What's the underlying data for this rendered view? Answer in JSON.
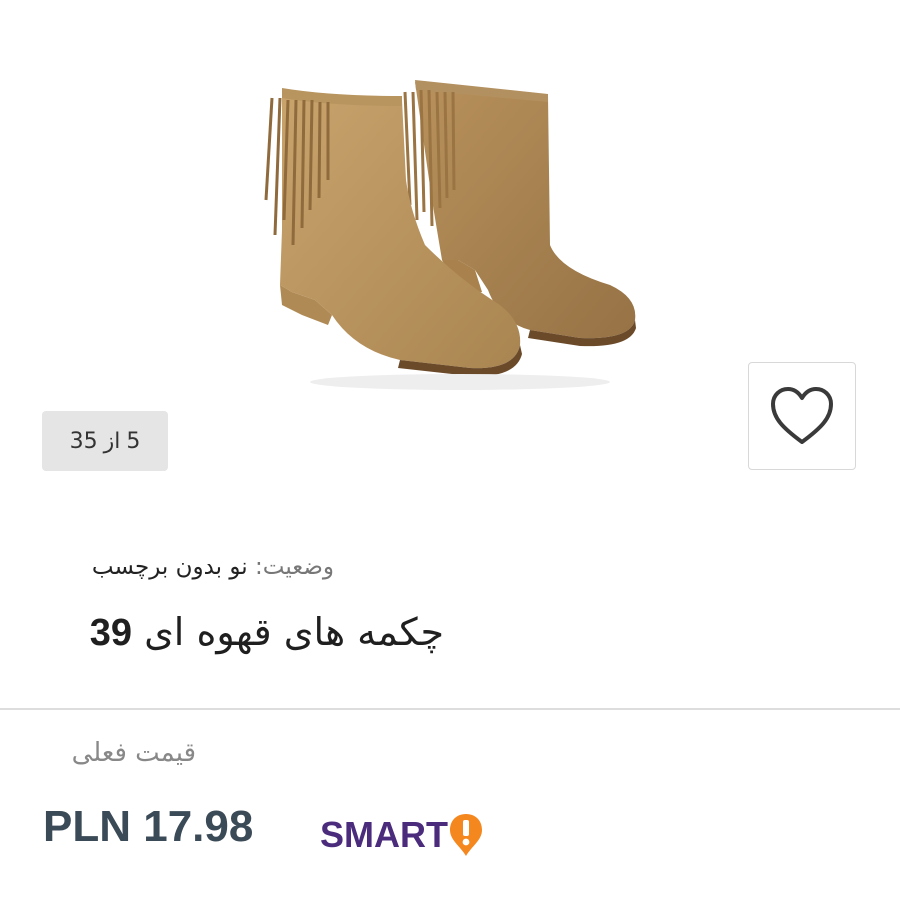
{
  "gallery": {
    "counter": {
      "current": "5",
      "separator": "از",
      "total": "35"
    },
    "favorite_icon": "heart-outline-icon"
  },
  "product": {
    "condition_label": "وضعیت:",
    "condition_value": "نو بدون برچسب",
    "title_text": "چکمه های قهوه ای",
    "title_number": "39"
  },
  "pricing": {
    "label": "قیمت فعلی",
    "value": "PLN 17.98",
    "badge_text": "SMART",
    "badge_colors": {
      "text": "#4a2b7c",
      "icon": "#f5871f"
    }
  },
  "colors": {
    "price_text": "#3b4a57",
    "counter_bg": "#e5e5e5",
    "divider": "#dddddd"
  }
}
